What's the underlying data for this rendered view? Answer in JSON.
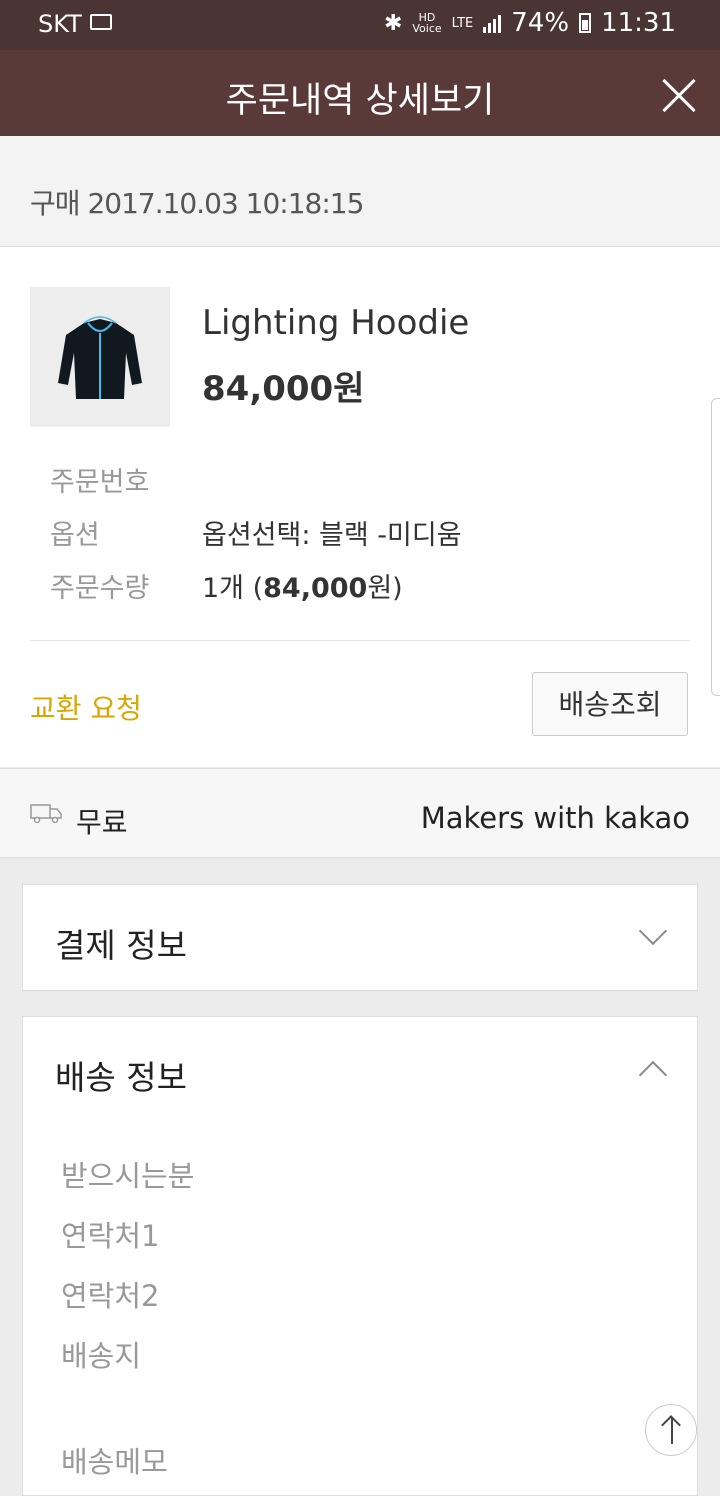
{
  "status_bar": {
    "carrier": "SKT",
    "hd_label": "HD",
    "voice_label": "Voice",
    "lte_label": "LTE",
    "battery": "74%",
    "time": "11:31"
  },
  "header": {
    "title": "주문내역 상세보기"
  },
  "purchase": {
    "label": "구매",
    "datetime": "2017.10.03 10:18:15"
  },
  "product": {
    "name": "Lighting Hoodie",
    "price": "84,000원",
    "order_number_label": "주문번호",
    "order_number_value": "",
    "option_label": "옵션",
    "option_value": "옵션선택: 블랙 -미디움",
    "quantity_label": "주문수량",
    "quantity_prefix": "1개 (",
    "quantity_amount": "84,000",
    "quantity_suffix": "원)",
    "exchange_label": "교환 요청",
    "track_label": "배송조회"
  },
  "shipping": {
    "fee": "무료",
    "seller": "Makers with kakao"
  },
  "payment_section": {
    "title": "결제 정보",
    "expanded": false
  },
  "delivery_section": {
    "title": "배송 정보",
    "expanded": true,
    "recipient_label": "받으시는분",
    "phone1_label": "연락처1",
    "phone2_label": "연락처2",
    "address_label": "배송지",
    "memo_label": "배송메모"
  },
  "colors": {
    "header": "#5a3939",
    "status_bar": "#4a3434",
    "accent": "#d9a600"
  },
  "icons": [
    "envelope-icon",
    "bluetooth-icon",
    "signal-icon",
    "battery-icon",
    "close-icon",
    "truck-icon",
    "chevron-down-icon",
    "chevron-up-icon",
    "arrow-up-icon"
  ]
}
